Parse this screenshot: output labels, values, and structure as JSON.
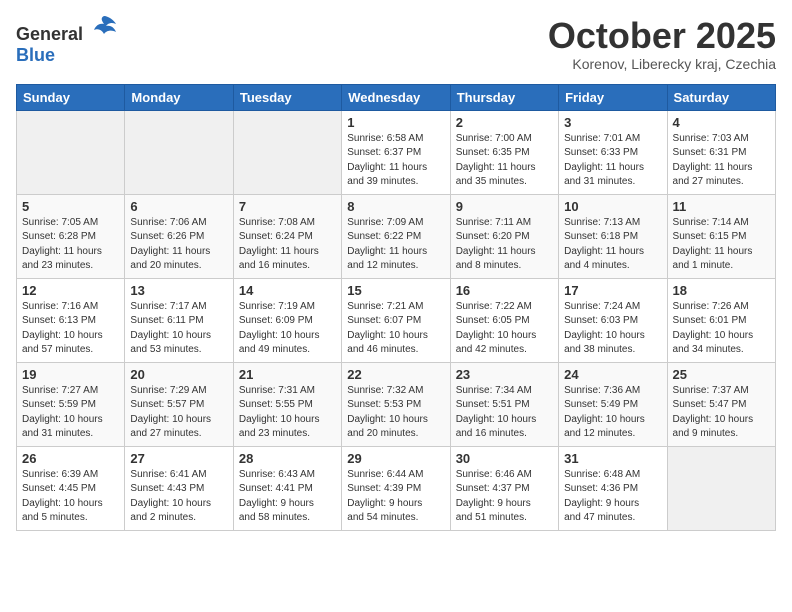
{
  "logo": {
    "general": "General",
    "blue": "Blue"
  },
  "header": {
    "month": "October 2025",
    "location": "Korenov, Liberecky kraj, Czechia"
  },
  "weekdays": [
    "Sunday",
    "Monday",
    "Tuesday",
    "Wednesday",
    "Thursday",
    "Friday",
    "Saturday"
  ],
  "weeks": [
    [
      {
        "day": "",
        "info": ""
      },
      {
        "day": "",
        "info": ""
      },
      {
        "day": "",
        "info": ""
      },
      {
        "day": "1",
        "info": "Sunrise: 6:58 AM\nSunset: 6:37 PM\nDaylight: 11 hours\nand 39 minutes."
      },
      {
        "day": "2",
        "info": "Sunrise: 7:00 AM\nSunset: 6:35 PM\nDaylight: 11 hours\nand 35 minutes."
      },
      {
        "day": "3",
        "info": "Sunrise: 7:01 AM\nSunset: 6:33 PM\nDaylight: 11 hours\nand 31 minutes."
      },
      {
        "day": "4",
        "info": "Sunrise: 7:03 AM\nSunset: 6:31 PM\nDaylight: 11 hours\nand 27 minutes."
      }
    ],
    [
      {
        "day": "5",
        "info": "Sunrise: 7:05 AM\nSunset: 6:28 PM\nDaylight: 11 hours\nand 23 minutes."
      },
      {
        "day": "6",
        "info": "Sunrise: 7:06 AM\nSunset: 6:26 PM\nDaylight: 11 hours\nand 20 minutes."
      },
      {
        "day": "7",
        "info": "Sunrise: 7:08 AM\nSunset: 6:24 PM\nDaylight: 11 hours\nand 16 minutes."
      },
      {
        "day": "8",
        "info": "Sunrise: 7:09 AM\nSunset: 6:22 PM\nDaylight: 11 hours\nand 12 minutes."
      },
      {
        "day": "9",
        "info": "Sunrise: 7:11 AM\nSunset: 6:20 PM\nDaylight: 11 hours\nand 8 minutes."
      },
      {
        "day": "10",
        "info": "Sunrise: 7:13 AM\nSunset: 6:18 PM\nDaylight: 11 hours\nand 4 minutes."
      },
      {
        "day": "11",
        "info": "Sunrise: 7:14 AM\nSunset: 6:15 PM\nDaylight: 11 hours\nand 1 minute."
      }
    ],
    [
      {
        "day": "12",
        "info": "Sunrise: 7:16 AM\nSunset: 6:13 PM\nDaylight: 10 hours\nand 57 minutes."
      },
      {
        "day": "13",
        "info": "Sunrise: 7:17 AM\nSunset: 6:11 PM\nDaylight: 10 hours\nand 53 minutes."
      },
      {
        "day": "14",
        "info": "Sunrise: 7:19 AM\nSunset: 6:09 PM\nDaylight: 10 hours\nand 49 minutes."
      },
      {
        "day": "15",
        "info": "Sunrise: 7:21 AM\nSunset: 6:07 PM\nDaylight: 10 hours\nand 46 minutes."
      },
      {
        "day": "16",
        "info": "Sunrise: 7:22 AM\nSunset: 6:05 PM\nDaylight: 10 hours\nand 42 minutes."
      },
      {
        "day": "17",
        "info": "Sunrise: 7:24 AM\nSunset: 6:03 PM\nDaylight: 10 hours\nand 38 minutes."
      },
      {
        "day": "18",
        "info": "Sunrise: 7:26 AM\nSunset: 6:01 PM\nDaylight: 10 hours\nand 34 minutes."
      }
    ],
    [
      {
        "day": "19",
        "info": "Sunrise: 7:27 AM\nSunset: 5:59 PM\nDaylight: 10 hours\nand 31 minutes."
      },
      {
        "day": "20",
        "info": "Sunrise: 7:29 AM\nSunset: 5:57 PM\nDaylight: 10 hours\nand 27 minutes."
      },
      {
        "day": "21",
        "info": "Sunrise: 7:31 AM\nSunset: 5:55 PM\nDaylight: 10 hours\nand 23 minutes."
      },
      {
        "day": "22",
        "info": "Sunrise: 7:32 AM\nSunset: 5:53 PM\nDaylight: 10 hours\nand 20 minutes."
      },
      {
        "day": "23",
        "info": "Sunrise: 7:34 AM\nSunset: 5:51 PM\nDaylight: 10 hours\nand 16 minutes."
      },
      {
        "day": "24",
        "info": "Sunrise: 7:36 AM\nSunset: 5:49 PM\nDaylight: 10 hours\nand 12 minutes."
      },
      {
        "day": "25",
        "info": "Sunrise: 7:37 AM\nSunset: 5:47 PM\nDaylight: 10 hours\nand 9 minutes."
      }
    ],
    [
      {
        "day": "26",
        "info": "Sunrise: 6:39 AM\nSunset: 4:45 PM\nDaylight: 10 hours\nand 5 minutes."
      },
      {
        "day": "27",
        "info": "Sunrise: 6:41 AM\nSunset: 4:43 PM\nDaylight: 10 hours\nand 2 minutes."
      },
      {
        "day": "28",
        "info": "Sunrise: 6:43 AM\nSunset: 4:41 PM\nDaylight: 9 hours\nand 58 minutes."
      },
      {
        "day": "29",
        "info": "Sunrise: 6:44 AM\nSunset: 4:39 PM\nDaylight: 9 hours\nand 54 minutes."
      },
      {
        "day": "30",
        "info": "Sunrise: 6:46 AM\nSunset: 4:37 PM\nDaylight: 9 hours\nand 51 minutes."
      },
      {
        "day": "31",
        "info": "Sunrise: 6:48 AM\nSunset: 4:36 PM\nDaylight: 9 hours\nand 47 minutes."
      },
      {
        "day": "",
        "info": ""
      }
    ]
  ]
}
